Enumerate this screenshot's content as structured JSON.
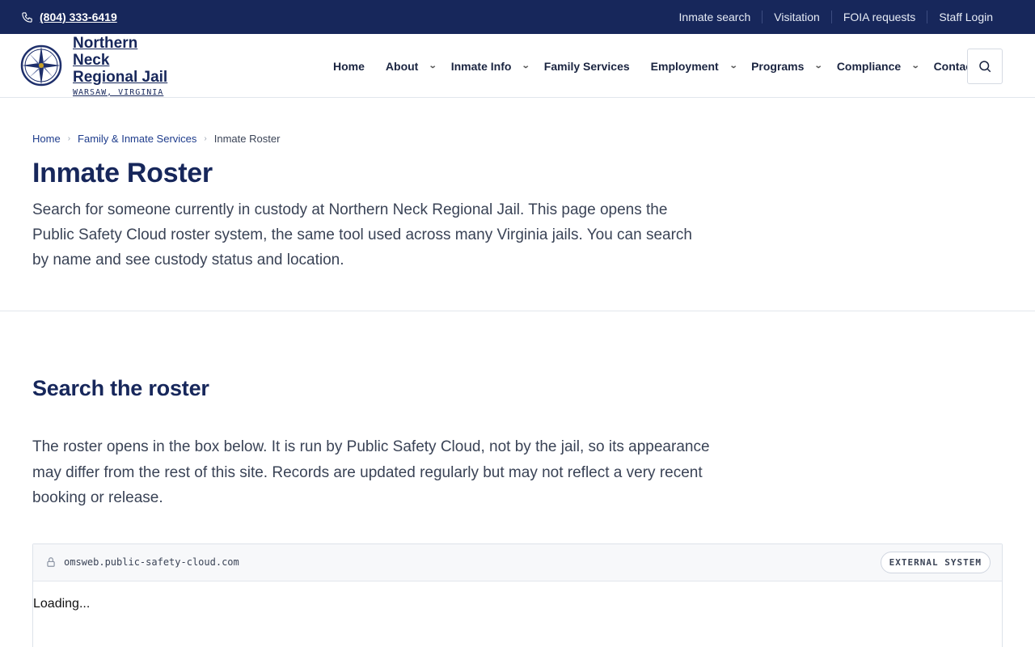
{
  "topbar": {
    "phone": "(804) 333-6419",
    "links": [
      "Inmate search",
      "Visitation",
      "FOIA requests",
      "Staff Login"
    ]
  },
  "brand": {
    "name": "Northern Neck Regional Jail",
    "location": "WARSAW, VIRGINIA"
  },
  "nav": {
    "items": [
      {
        "label": "Home",
        "has_menu": false
      },
      {
        "label": "About",
        "has_menu": true
      },
      {
        "label": "Inmate Info",
        "has_menu": true
      },
      {
        "label": "Family Services",
        "has_menu": false
      },
      {
        "label": "Employment",
        "has_menu": true
      },
      {
        "label": "Programs",
        "has_menu": true
      },
      {
        "label": "Compliance",
        "has_menu": true
      },
      {
        "label": "Contact",
        "has_menu": false
      }
    ]
  },
  "breadcrumb": {
    "home": "Home",
    "parent": "Family & Inmate Services",
    "current": "Inmate Roster"
  },
  "hero": {
    "title": "Inmate Roster",
    "lead": "Search for someone currently in custody at Northern Neck Regional Jail. This page opens the Public Safety Cloud roster system, the same tool used across many Virginia jails. You can search by name and see custody status and location."
  },
  "section": {
    "title": "Search the roster",
    "body": "The roster opens in the box below. It is run by Public Safety Cloud, not by the jail, so its appearance may differ from the rest of this site. Records are updated regularly but may not reflect a very recent booking or release."
  },
  "embed": {
    "url": "omsweb.public-safety-cloud.com",
    "badge": "EXTERNAL SYSTEM",
    "status": "Loading..."
  },
  "colors": {
    "brand_navy": "#17275b",
    "link_blue": "#1e3c8c"
  }
}
